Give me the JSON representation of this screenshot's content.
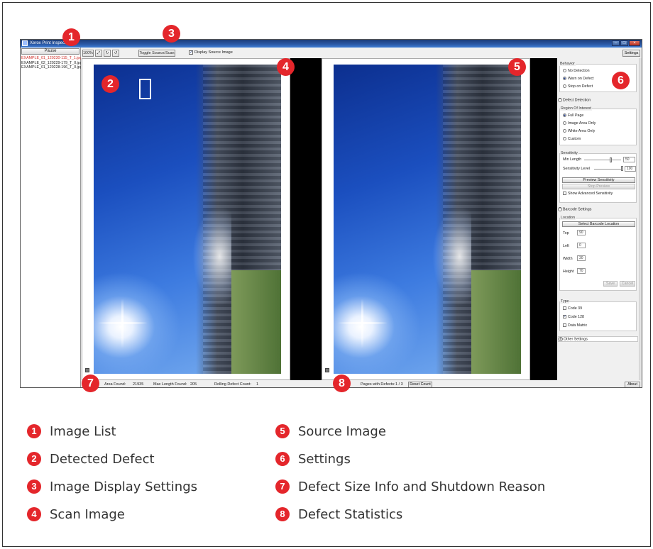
{
  "window": {
    "title": "Xerox Print Inspector"
  },
  "left_panel": {
    "pause_label": "Pause",
    "images": [
      {
        "name": "EXAMPLE_01_120230-115_T_1.jpg",
        "selected": true
      },
      {
        "name": "EXAMPLE_02_120229-179_T_0.jpg",
        "selected": false
      },
      {
        "name": "EXAMPLE_01_120228-196_T_0.jpg",
        "selected": false
      }
    ]
  },
  "toolbar": {
    "zoom_label": "100%",
    "fit_icon": "fit-to-window-icon",
    "rotate_cw_icon": "rotate-clockwise-icon",
    "rotate_ccw_icon": "rotate-counterclockwise-icon",
    "toggle_label": "Toggle Source/Scan",
    "display_source_label": "Display Source Image",
    "display_source_checked": true,
    "settings_label": "Settings"
  },
  "settings": {
    "behavior": {
      "label": "Behavior",
      "options": [
        "No Detection",
        "Warn on Defect",
        "Stop on Defect"
      ],
      "selected": 1
    },
    "defect_detection_label": "Defect Detection",
    "region": {
      "label": "Region Of Interest",
      "options": [
        "Full Page",
        "Image Area Only",
        "White Area Only",
        "Custom"
      ],
      "selected": 0
    },
    "sensitivity": {
      "label": "Sensitivity",
      "min_length_label": "Min Length",
      "min_length_value": "50",
      "level_label": "Sensitivity Level",
      "level_value": "100",
      "preview_label": "Preview Sensitivity",
      "stop_preview_label": "Stop Preview",
      "advanced_label": "Show Advanced Sensitivity"
    },
    "barcode_settings_label": "Barcode Settings",
    "location": {
      "label": "Location",
      "select_label": "Select Barcode Location",
      "top_label": "Top",
      "top_value": "90",
      "left_label": "Left",
      "left_value": "0",
      "width_label": "Width",
      "width_value": "30",
      "height_label": "Height",
      "height_value": "70",
      "save_label": "Save",
      "cancel_label": "Cancel"
    },
    "type": {
      "label": "Type",
      "options": [
        {
          "label": "Code 39",
          "checked": false
        },
        {
          "label": "Code 128",
          "checked": true
        },
        {
          "label": "Data Matrix",
          "checked": false
        }
      ]
    },
    "other_settings_label": "Other Settings"
  },
  "statusbar": {
    "area_label": "Area Found:",
    "area_value": "21935",
    "max_length_label": "Max Length Found:",
    "max_length_value": "205",
    "rolling_label": "Rolling Defect Count:",
    "rolling_value": "1",
    "pages_label": "Pages with Defects:",
    "pages_value": "1 / 3",
    "reset_label": "Reset Count",
    "about_label": "About"
  },
  "badges": [
    "1",
    "2",
    "3",
    "4",
    "5",
    "6",
    "7",
    "8"
  ],
  "legend": [
    {
      "num": "1",
      "text": "Image List"
    },
    {
      "num": "2",
      "text": "Detected Defect"
    },
    {
      "num": "3",
      "text": "Image Display Settings"
    },
    {
      "num": "4",
      "text": "Scan Image"
    },
    {
      "num": "5",
      "text": "Source Image"
    },
    {
      "num": "6",
      "text": "Settings"
    },
    {
      "num": "7",
      "text": "Defect Size Info and Shutdown Reason"
    },
    {
      "num": "8",
      "text": "Defect Statistics"
    }
  ],
  "colors": {
    "accent": "#e4262b",
    "selected_item": "#d0302a",
    "titlebar": "#2b5aa8"
  }
}
